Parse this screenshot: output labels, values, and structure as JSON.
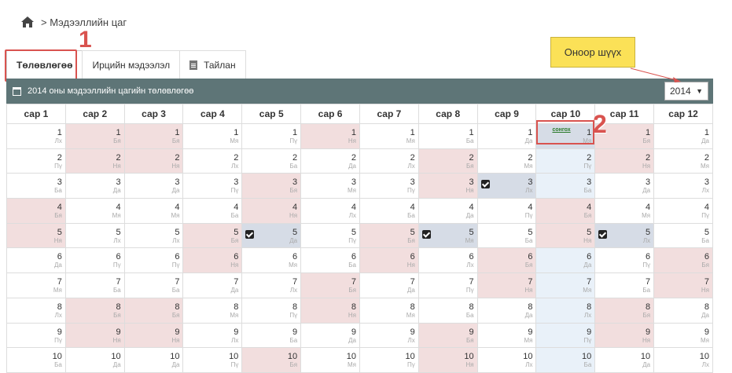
{
  "breadcrumb": {
    "home_icon": "home-icon",
    "text": "> Мэдээллийн цаг"
  },
  "tabs": [
    {
      "label": "Төлөвлөгөө"
    },
    {
      "label": "Ирцийн мэдээлэл"
    },
    {
      "label": "Тайлан"
    }
  ],
  "tooltip": {
    "text": "Оноор шүүх"
  },
  "panel": {
    "title": "2014 оны мэдээллийн цагийн төлөвлөгөө"
  },
  "year_select": {
    "value": "2014"
  },
  "annotations": {
    "one": "1",
    "two": "2"
  },
  "calendar": {
    "months": [
      "сар 1",
      "сар 2",
      "сар 3",
      "сар 4",
      "сар 5",
      "сар 6",
      "сар 7",
      "сар 8",
      "сар 9",
      "сар 10",
      "сар 11",
      "сар 12"
    ],
    "choose_label": "сонгох",
    "rows": [
      {
        "day": "1",
        "dow": [
          "Лх",
          "Бя",
          "Бя",
          "Мя",
          "Пү",
          "Ня",
          "Мя",
          "Ба",
          "Да",
          "Мя",
          "Бя",
          "Да"
        ]
      },
      {
        "day": "2",
        "dow": [
          "Пү",
          "Ня",
          "Ня",
          "Лх",
          "Ба",
          "Да",
          "Лх",
          "Бя",
          "Мя",
          "Пү",
          "Ня",
          "Мя"
        ]
      },
      {
        "day": "3",
        "dow": [
          "Ба",
          "Да",
          "Да",
          "Пү",
          "Бя",
          "Мя",
          "Пү",
          "Ня",
          "Лх",
          "Ба",
          "Да",
          "Лх"
        ]
      },
      {
        "day": "4",
        "dow": [
          "Бя",
          "Мя",
          "Мя",
          "Ба",
          "Ня",
          "Лх",
          "Ба",
          "Да",
          "Пү",
          "Бя",
          "Мя",
          "Пү"
        ]
      },
      {
        "day": "5",
        "dow": [
          "Ня",
          "Лх",
          "Лх",
          "Бя",
          "Да",
          "Пү",
          "Бя",
          "Мя",
          "Ба",
          "Ня",
          "Лх",
          "Ба"
        ]
      },
      {
        "day": "6",
        "dow": [
          "Да",
          "Пү",
          "Пү",
          "Ня",
          "Мя",
          "Ба",
          "Ня",
          "Лх",
          "Бя",
          "Да",
          "Пү",
          "Бя"
        ]
      },
      {
        "day": "7",
        "dow": [
          "Мя",
          "Ба",
          "Ба",
          "Да",
          "Лх",
          "Бя",
          "Да",
          "Пү",
          "Ня",
          "Мя",
          "Ба",
          "Ня"
        ]
      },
      {
        "day": "8",
        "dow": [
          "Лх",
          "Бя",
          "Бя",
          "Мя",
          "Пү",
          "Ня",
          "Мя",
          "Ба",
          "Да",
          "Лх",
          "Бя",
          "Да"
        ]
      },
      {
        "day": "9",
        "dow": [
          "Пү",
          "Ня",
          "Ня",
          "Лх",
          "Ба",
          "Да",
          "Лх",
          "Бя",
          "Мя",
          "Пү",
          "Ня",
          "Мя"
        ]
      },
      {
        "day": "10",
        "dow": [
          "Ба",
          "Да",
          "Да",
          "Пү",
          "Бя",
          "Мя",
          "Пү",
          "Ня",
          "Лх",
          "Ба",
          "Да",
          "Лх"
        ]
      }
    ]
  },
  "colors": {
    "weekend": "#f2dede",
    "selected": "#d6dce6",
    "current_month": "#e9f1f9",
    "panel": "#5e7577",
    "highlight": "#d9534f",
    "tooltip": "#fbe157"
  }
}
